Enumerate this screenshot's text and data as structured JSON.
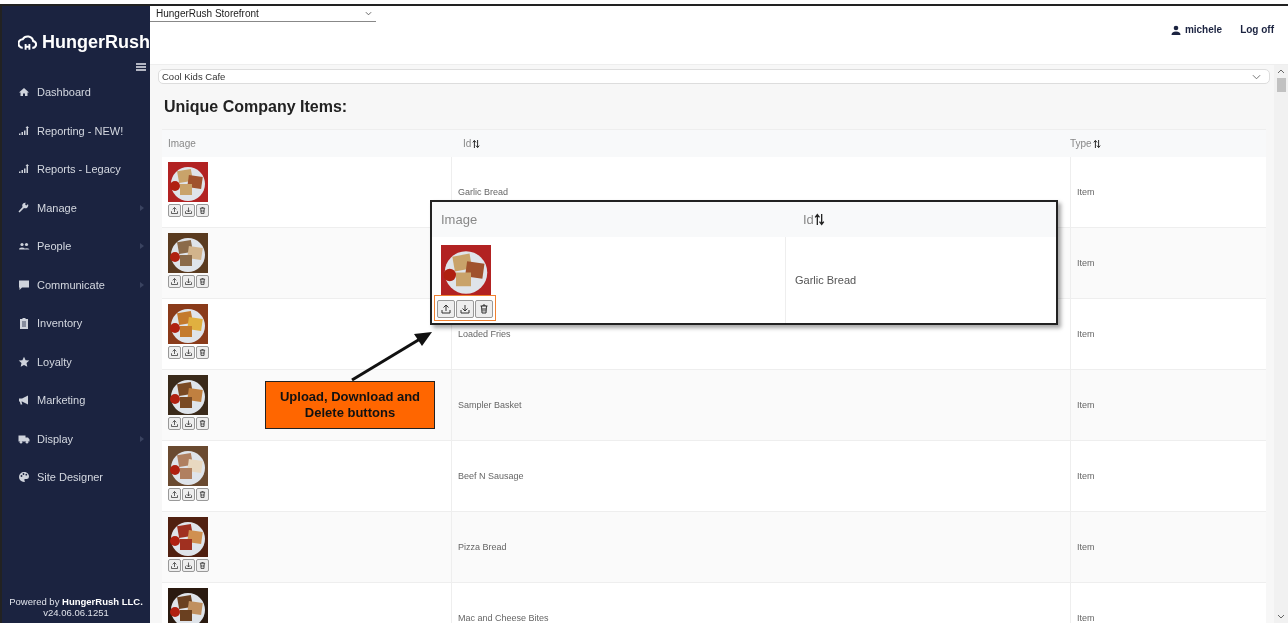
{
  "sidebar": {
    "brand": "HungerRush",
    "items": [
      {
        "label": "Dashboard",
        "kind": "home",
        "has_submenu": false
      },
      {
        "label": "Reporting - NEW!",
        "kind": "chart",
        "has_submenu": false
      },
      {
        "label": "Reports - Legacy",
        "kind": "chart",
        "has_submenu": false
      },
      {
        "label": "Manage",
        "kind": "wrench",
        "has_submenu": true
      },
      {
        "label": "People",
        "kind": "people",
        "has_submenu": true
      },
      {
        "label": "Communicate",
        "kind": "chat",
        "has_submenu": true
      },
      {
        "label": "Inventory",
        "kind": "clipboard",
        "has_submenu": false
      },
      {
        "label": "Loyalty",
        "kind": "star",
        "has_submenu": false
      },
      {
        "label": "Marketing",
        "kind": "megaphone",
        "has_submenu": false
      },
      {
        "label": "Display",
        "kind": "truck",
        "has_submenu": true
      },
      {
        "label": "Site Designer",
        "kind": "palette",
        "has_submenu": false
      }
    ],
    "footer": "Powered by **HungerRush LLC.**",
    "version": "v24.06.06.1251"
  },
  "header": {
    "store_select": "HungerRush Storefront",
    "user": "michele",
    "logoff": "Log off"
  },
  "location_select": "Cool Kids Cafe",
  "title": "Unique Company Items:",
  "table": {
    "columns": [
      "Image",
      "Id",
      "Type"
    ],
    "rows": [
      {
        "id": "Garlic Bread",
        "type": "Item"
      },
      {
        "type": "Item"
      },
      {
        "id": "Loaded Fries",
        "type": "Item"
      },
      {
        "id": "Sampler Basket",
        "type": "Item"
      },
      {
        "id": "Beef N Sausage",
        "type": "Item"
      },
      {
        "id": "Pizza Bread",
        "type": "Item"
      },
      {
        "id": "Mac and Cheese Bites",
        "type": "Item"
      }
    ]
  },
  "callout": {
    "columns": [
      "Image",
      "Id"
    ],
    "row": {
      "id": "Garlic Bread"
    },
    "label": "Upload, Download and Delete buttons"
  }
}
